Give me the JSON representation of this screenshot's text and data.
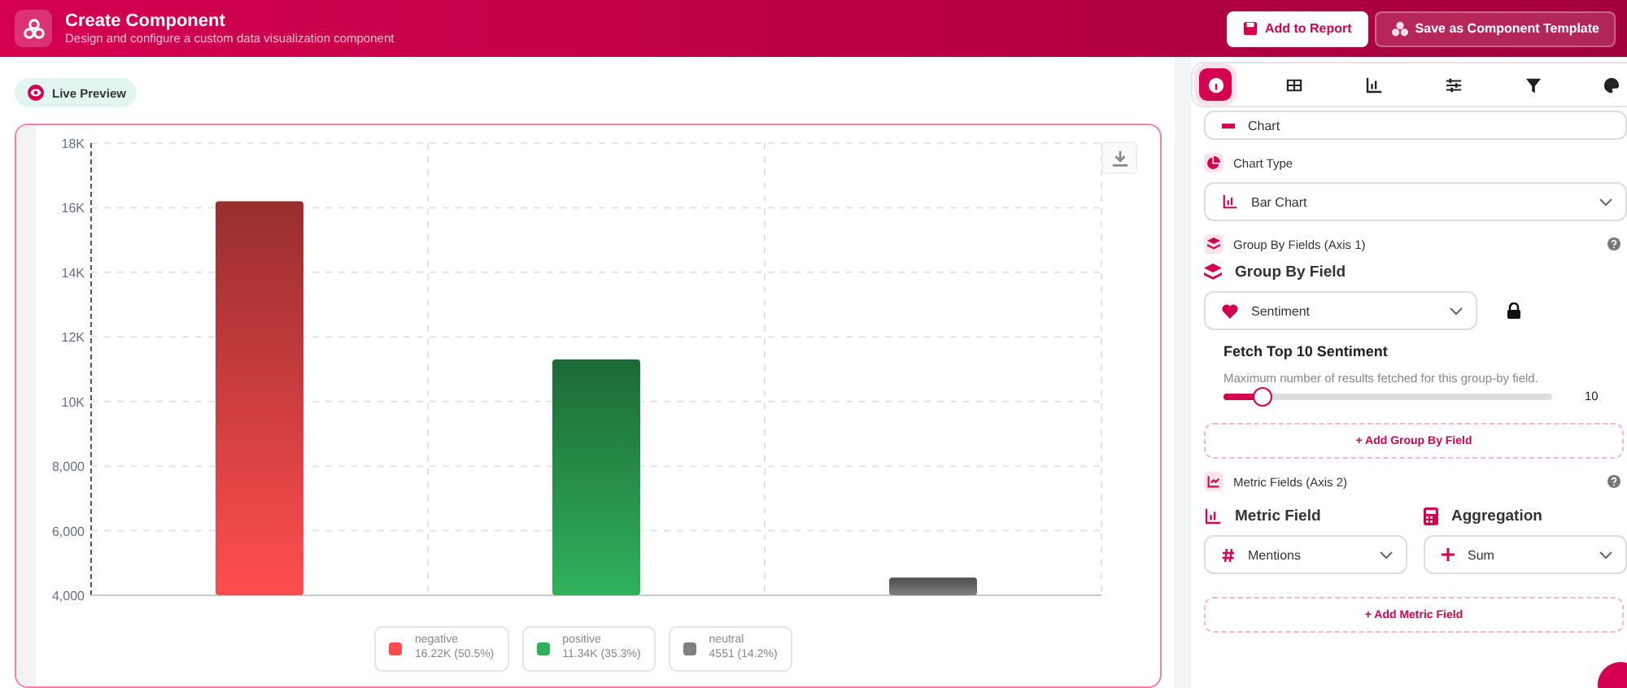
{
  "header": {
    "title": "Create Component",
    "subtitle": "Design and configure a custom data visualization component",
    "buttons": [
      {
        "label": "Add to Report",
        "kind": "primary"
      },
      {
        "label": "Save as Component Template",
        "kind": "secondary"
      }
    ]
  },
  "preview": {
    "badge": "Live Preview",
    "chart_data": {
      "type": "bar",
      "grid": true,
      "series": [
        {
          "name": "negative",
          "color": "#ff4d4f",
          "values": [
            16200
          ]
        },
        {
          "name": "positive",
          "color": "#2fb15a",
          "values": [
            11300
          ]
        },
        {
          "name": "neutral",
          "color": "#808080",
          "values": [
            4550
          ]
        }
      ],
      "ylim": [
        4000,
        18000
      ],
      "yticks": [
        {
          "value": 4000,
          "label": "4,000"
        },
        {
          "value": 6000,
          "label": "6,000"
        },
        {
          "value": 8000,
          "label": "8,000"
        },
        {
          "value": 10000,
          "label": "10K"
        },
        {
          "value": 12000,
          "label": "12K"
        },
        {
          "value": 14000,
          "label": "14K"
        },
        {
          "value": 16000,
          "label": "16K"
        },
        {
          "value": 18000,
          "label": "18K"
        }
      ]
    },
    "legend_readings": [
      "16.22K (50.5%)",
      "11.34K (35.3%)",
      "4551 (14.2%)"
    ]
  },
  "panel": {
    "tabs": [
      {
        "kind": "info",
        "selected": true
      },
      {
        "kind": "table",
        "selected": false
      },
      {
        "kind": "chart",
        "selected": false
      },
      {
        "kind": "sliders",
        "selected": false
      },
      {
        "kind": "filter",
        "selected": false
      },
      {
        "kind": "palette",
        "selected": false
      }
    ],
    "component_type": {
      "value": "Chart"
    },
    "chart_type": {
      "label": "Chart Type",
      "value": "Bar Chart"
    },
    "group_by": {
      "section": "Group By Fields (Axis 1)",
      "heading": "Group By Field",
      "value": "Sentiment",
      "locked": true,
      "fetch_title": "Fetch Top 10 Sentiment",
      "fetch_hint": "Maximum number of results fetched for this group-by field.",
      "level": 0.12,
      "reading": "10",
      "add": "+ Add Group By Field"
    },
    "metrics": {
      "section": "Metric Fields (Axis 2)",
      "field_heading": "Metric Field",
      "field_value": "Mentions",
      "agg_heading": "Aggregation",
      "agg_value": "Sum",
      "add": "+ Add Metric Field"
    }
  }
}
